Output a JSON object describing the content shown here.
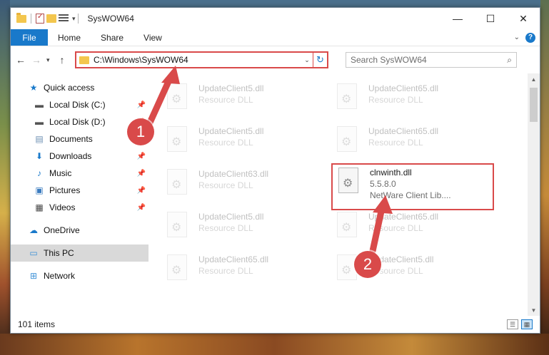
{
  "title": "SysWOW64",
  "window_controls": {
    "minimize": "—",
    "maximize": "☐",
    "close": "✕"
  },
  "ribbon": {
    "file": "File",
    "tabs": [
      "Home",
      "Share",
      "View"
    ],
    "help": "?"
  },
  "nav": {
    "back": "←",
    "forward": "→",
    "recent": "▾",
    "up": "↑"
  },
  "address": {
    "path": "C:\\Windows\\SysWOW64",
    "refresh": "↻",
    "dropdown": "⌄"
  },
  "search": {
    "placeholder": "Search SysWOW64",
    "icon": "⌕"
  },
  "sidebar": {
    "quick_access": "Quick access",
    "items": [
      {
        "label": "Local Disk (C:)",
        "pinned": true
      },
      {
        "label": "Local Disk (D:)",
        "pinned": true
      },
      {
        "label": "Documents",
        "pinned": true
      },
      {
        "label": "Downloads",
        "pinned": true
      },
      {
        "label": "Music",
        "pinned": true
      },
      {
        "label": "Pictures",
        "pinned": true
      },
      {
        "label": "Videos",
        "pinned": true
      }
    ],
    "onedrive": "OneDrive",
    "this_pc": "This PC",
    "network": "Network",
    "pin_glyph": "📌"
  },
  "files": [
    {
      "name": "UpdateClient5.dll",
      "desc": "Resource DLL"
    },
    {
      "name": "UpdateClient65.dll",
      "desc": "Resource DLL"
    },
    {
      "name": "UpdateClient5.dll",
      "desc": "Resource DLL"
    },
    {
      "name": "UpdateClient65.dll",
      "desc": "Resource DLL"
    },
    {
      "name": "UpdateClient63.dll",
      "desc": "Resource DLL"
    },
    {
      "name": "UpdateClient5.dll",
      "desc": "Resource DLL"
    },
    {
      "name": "UpdateClient65.dll",
      "desc": "Resource DLL"
    },
    {
      "name": "UpdateClient65.dll",
      "desc": "Resource DLL"
    },
    {
      "name": "UpdateClient5.dll",
      "desc": "Resource DLL"
    }
  ],
  "selected_file": {
    "name": "clnwinth.dll",
    "version": "5.5.8.0",
    "desc": "NetWare Client Lib...."
  },
  "status": {
    "count": "101 items"
  },
  "annotations": {
    "step1": "1",
    "step2": "2",
    "color": "#d94a4a"
  },
  "colors": {
    "accent": "#1979ca",
    "highlight": "#d94a4a"
  }
}
